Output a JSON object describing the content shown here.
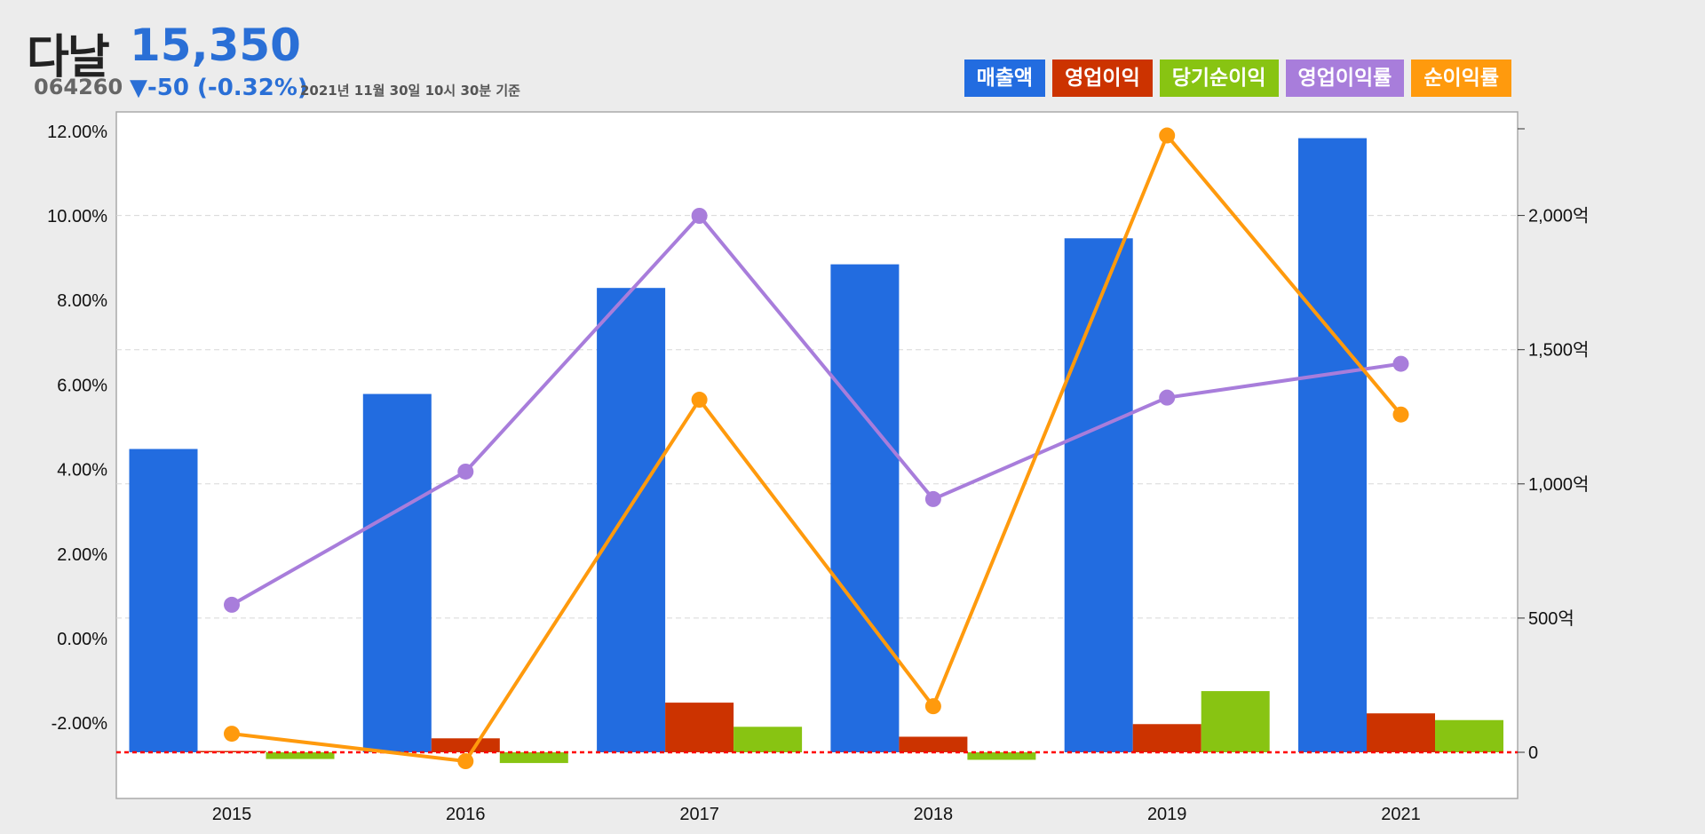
{
  "header": {
    "name": "다날",
    "price": "15,350",
    "code": "064260",
    "change": "▼-50 (-0.32%)",
    "timestamp": "2021년 11월 30일 10시 30분 기준"
  },
  "colors": {
    "background": "#ececec",
    "plot_background": "#ffffff",
    "revenue": "#226ce0",
    "operating_profit": "#cc3300",
    "net_income": "#88c412",
    "operating_margin": "#a87ddb",
    "net_margin": "#ff9a0d",
    "zero_line": "#ff0000"
  },
  "chart_data": {
    "type": "bar",
    "categories": [
      "2015",
      "2016",
      "2017",
      "2018",
      "2019",
      "2021"
    ],
    "legend": [
      "매출액",
      "영업이익",
      "당기순이익",
      "영업이익률",
      "순이익률"
    ],
    "legend_position": "top-right",
    "left_axis": {
      "ticks": [
        "-2.00%",
        "0.00%",
        "2.00%",
        "4.00%",
        "6.00%",
        "8.00%",
        "10.00%",
        "12.00%"
      ],
      "ylim": [
        -3.2,
        12.4
      ]
    },
    "right_axis": {
      "ticks": [
        "0",
        "500억",
        "1,000억",
        "1,500억",
        "2,000억"
      ],
      "ylim": [
        -57,
        2300
      ]
    },
    "grid": true,
    "bar_series": [
      {
        "name": "매출액",
        "axis": "right",
        "values": [
          1130,
          1335,
          1730,
          1818,
          1915,
          2288
        ]
      },
      {
        "name": "영업이익",
        "axis": "right",
        "values": [
          5,
          52,
          185,
          58,
          105,
          145
        ]
      },
      {
        "name": "당기순이익",
        "axis": "right",
        "values": [
          -25,
          -40,
          95,
          -28,
          228,
          120
        ]
      }
    ],
    "line_series": [
      {
        "name": "영업이익률",
        "axis": "left",
        "values": [
          0.8,
          3.95,
          10.0,
          3.3,
          5.7,
          6.5
        ]
      },
      {
        "name": "순이익률",
        "axis": "left",
        "values": [
          -2.25,
          -2.9,
          5.65,
          -1.6,
          11.9,
          5.3
        ]
      }
    ]
  }
}
